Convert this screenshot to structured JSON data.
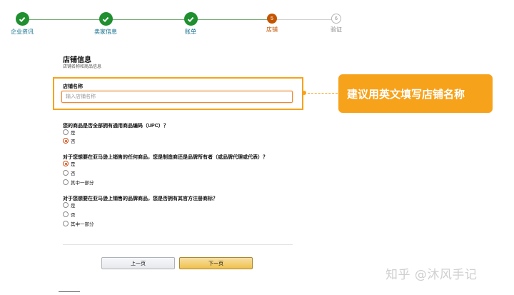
{
  "stepper": {
    "steps": [
      {
        "number": "",
        "label": "企业资讯",
        "state": "done"
      },
      {
        "number": "",
        "label": "卖家信息",
        "state": "done"
      },
      {
        "number": "",
        "label": "账单",
        "state": "done"
      },
      {
        "number": "5",
        "label": "店铺",
        "state": "current"
      },
      {
        "number": "6",
        "label": "验证",
        "state": "todo"
      }
    ],
    "colors": {
      "done": "#1f8f2f",
      "current": "#c45500",
      "todo": "#b5b5b5"
    }
  },
  "section": {
    "title": "店铺信息",
    "subtitle": "店铺名称和商品信息"
  },
  "store_name": {
    "label": "店铺名称",
    "placeholder": "输入店铺名称",
    "value": ""
  },
  "callout": {
    "text": "建议用英文填写店铺名称",
    "color": "#f7a21b"
  },
  "questions": [
    {
      "text": "您的商品是否全部拥有通用商品编码（UPC）？",
      "options": [
        {
          "label": "是",
          "selected": false
        },
        {
          "label": "否",
          "selected": true
        }
      ]
    },
    {
      "text": "对于您想要在亚马逊上销售的任何商品，您是制造商还是品牌所有者（或品牌代理或代表）？",
      "options": [
        {
          "label": "是",
          "selected": true
        },
        {
          "label": "否",
          "selected": false
        },
        {
          "label": "其中一部分",
          "selected": false
        }
      ]
    },
    {
      "text": "对于您想要在亚马逊上销售的品牌商品，您是否拥有其官方注册商标？",
      "options": [
        {
          "label": "是",
          "selected": false
        },
        {
          "label": "否",
          "selected": false
        },
        {
          "label": "其中一部分",
          "selected": false
        }
      ]
    }
  ],
  "buttons": {
    "prev": "上一页",
    "next": "下一页"
  },
  "watermark": "知乎 @沐风手记"
}
